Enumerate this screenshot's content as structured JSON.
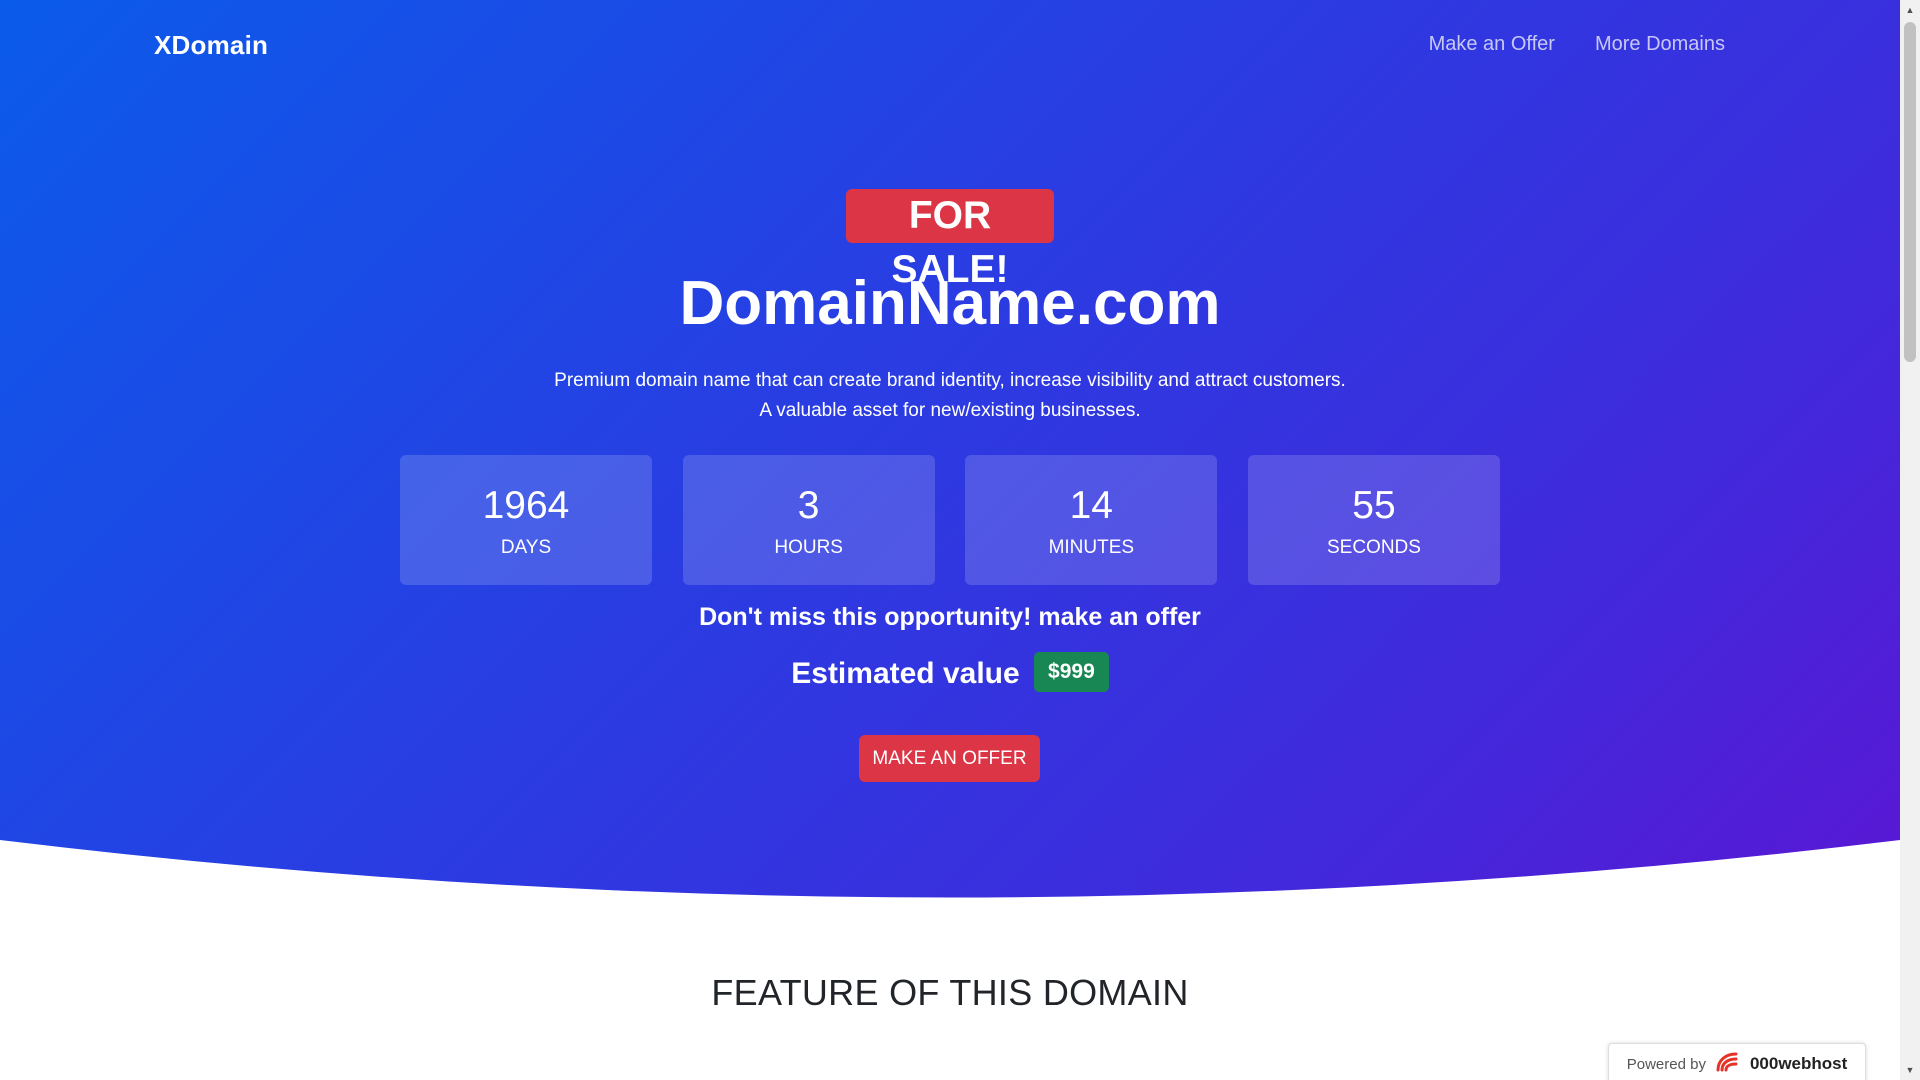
{
  "navbar": {
    "brand": "XDomain",
    "links": [
      {
        "label": "Make an Offer"
      },
      {
        "label": "More Domains"
      }
    ]
  },
  "hero": {
    "badge": "FOR SALE!",
    "domain": "DomainName.com",
    "tagline_line1": "Premium domain name that can create brand identity, increase visibility and attract customers.",
    "tagline_line2": "A valuable asset for new/existing businesses.",
    "countdown": [
      {
        "value": "1964",
        "label": "DAYS"
      },
      {
        "value": "3",
        "label": "HOURS"
      },
      {
        "value": "14",
        "label": "MINUTES"
      },
      {
        "value": "55",
        "label": "SECONDS"
      }
    ],
    "opportunity": "Don't miss this opportunity! make an offer",
    "estimate_label": "Estimated value",
    "estimate_price": "$999",
    "cta_label": "MAKE AN OFFER"
  },
  "features": {
    "heading": "FEATURE OF THIS DOMAIN"
  },
  "powered_by": {
    "prefix": "Powered by",
    "brand": "000webhost"
  },
  "colors": {
    "gradient_start": "#0b5bea",
    "gradient_end": "#5a17d4",
    "danger": "#dc3545",
    "success": "#198754",
    "heading_text": "#212529"
  },
  "icons": {
    "powered_logo": "webhost-swirl-icon",
    "scroll_up": "scroll-up-arrow-icon",
    "scroll_down": "scroll-down-arrow-icon"
  }
}
